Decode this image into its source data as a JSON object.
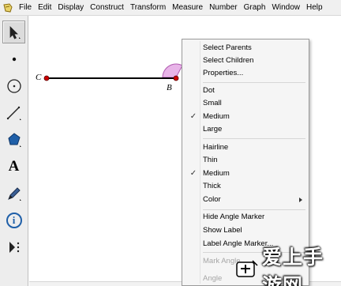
{
  "menubar": {
    "items": [
      "File",
      "Edit",
      "Display",
      "Construct",
      "Transform",
      "Measure",
      "Number",
      "Graph",
      "Window",
      "Help"
    ]
  },
  "toolbox": {
    "tools": [
      {
        "name": "arrow-select-tool",
        "icon": "arrow-icon",
        "selected": true
      },
      {
        "name": "point-tool",
        "icon": "dot-icon"
      },
      {
        "name": "compass-tool",
        "icon": "circle-icon"
      },
      {
        "name": "straightedge-tool",
        "icon": "line-icon"
      },
      {
        "name": "polygon-tool",
        "icon": "polygon-icon"
      },
      {
        "name": "text-tool",
        "icon": "text-icon",
        "label": "A"
      },
      {
        "name": "marker-tool",
        "icon": "pen-icon"
      },
      {
        "name": "information-tool",
        "icon": "info-icon",
        "label": "i"
      },
      {
        "name": "custom-tool",
        "icon": "play-dots-icon"
      }
    ]
  },
  "canvas": {
    "points": {
      "c_label": "C",
      "b_label": "B"
    },
    "colors": {
      "segment": "#000000",
      "point": "#cc0000",
      "angle_marker": "#e8b4e8"
    }
  },
  "context_menu": {
    "items": [
      {
        "label": "Select Parents"
      },
      {
        "label": "Select Children"
      },
      {
        "label": "Properties..."
      },
      {
        "separator": true
      },
      {
        "label": "Dot"
      },
      {
        "label": "Small"
      },
      {
        "label": "Medium",
        "checked": true
      },
      {
        "label": "Large"
      },
      {
        "separator": true
      },
      {
        "label": "Hairline"
      },
      {
        "label": "Thin"
      },
      {
        "label": "Medium",
        "checked": true
      },
      {
        "label": "Thick"
      },
      {
        "label": "Color",
        "submenu": true
      },
      {
        "separator": true
      },
      {
        "label": "Hide Angle Marker"
      },
      {
        "label": "Show Label"
      },
      {
        "label": "Label Angle Marker..."
      },
      {
        "separator": true
      },
      {
        "label": "Mark Angle",
        "disabled": true
      },
      {
        "label": "Angle",
        "disabled": true
      }
    ],
    "check_glyph": "✓"
  },
  "watermark": {
    "text": "爱上手游网"
  }
}
